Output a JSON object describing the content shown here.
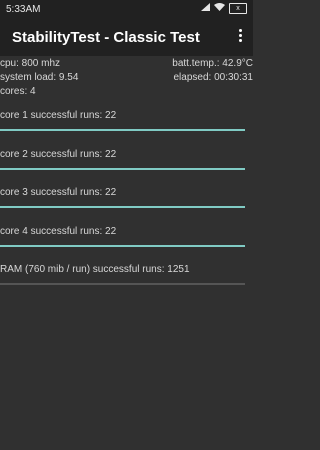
{
  "status_bar": {
    "time": "5:33AM",
    "battery_level": "x"
  },
  "app_bar": {
    "title": "StabilityTest - Classic Test"
  },
  "stats": {
    "cpu": "cpu: 800 mhz",
    "system_load": "system load: 9.54",
    "cores": "cores: 4",
    "batt_temp": "batt.temp.: 42.9°C",
    "elapsed": "elapsed: 00:30:31"
  },
  "tests": [
    {
      "label": "core 1 successful runs: 22",
      "progress": 1.0
    },
    {
      "label": "core 2 successful runs: 22",
      "progress": 1.0
    },
    {
      "label": "core 3 successful runs: 22",
      "progress": 1.0
    },
    {
      "label": "core 4 successful runs: 22",
      "progress": 1.0
    },
    {
      "label": "RAM (760 mib / run) successful runs: 1251",
      "progress": 0.0
    }
  ],
  "colors": {
    "accent": "#80cbc4",
    "background": "#303030",
    "bar": "#212121"
  }
}
